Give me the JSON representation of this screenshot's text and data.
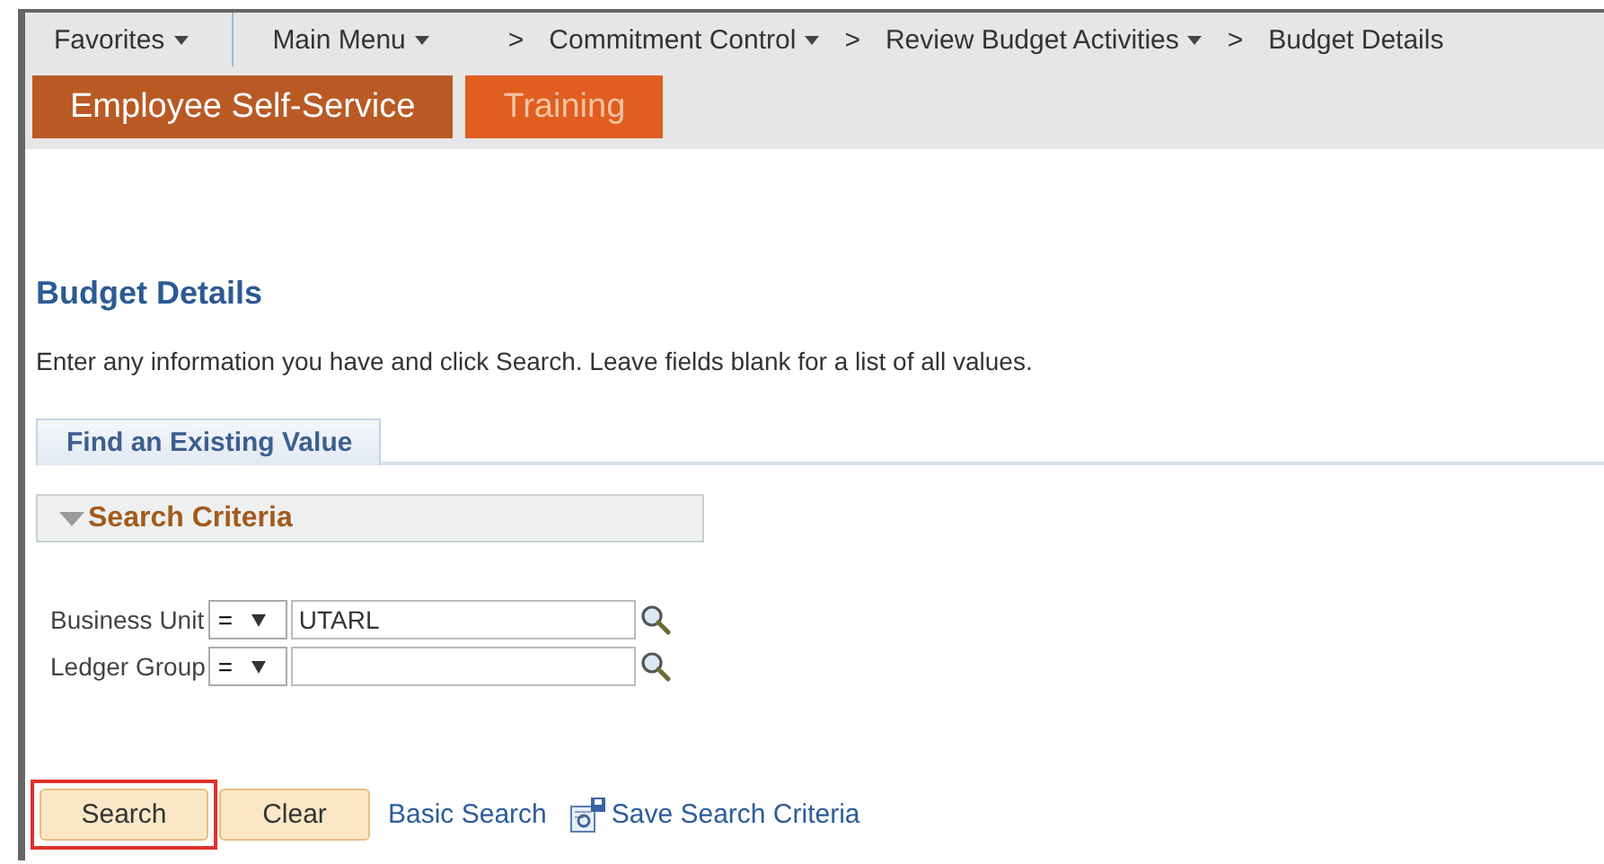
{
  "nav": [
    {
      "kind": "menu",
      "label": "Favorites",
      "dropdown": true
    },
    {
      "kind": "divider"
    },
    {
      "kind": "menu",
      "label": "Main Menu",
      "dropdown": true
    },
    {
      "kind": "separator",
      "label": ">"
    },
    {
      "kind": "menu",
      "label": "Commitment Control",
      "dropdown": true
    },
    {
      "kind": "separator",
      "label": ">"
    },
    {
      "kind": "menu",
      "label": "Review Budget Activities",
      "dropdown": true
    },
    {
      "kind": "separator",
      "label": ">"
    },
    {
      "kind": "menu",
      "label": "Budget Details",
      "dropdown": false
    }
  ],
  "home_tabs": [
    {
      "label": "Employee Self-Service",
      "selected": true
    },
    {
      "label": "Training",
      "selected": false
    }
  ],
  "page_title": "Budget Details",
  "instructions": "Enter any information you have and click Search. Leave fields blank for a list of all values.",
  "tabs": [
    {
      "label": "Find an Existing Value",
      "selected": true
    }
  ],
  "section": {
    "title": "Search Criteria",
    "expanded": true
  },
  "fields": [
    {
      "label": "Business Unit",
      "operator": "=",
      "value": "UTARL"
    },
    {
      "label": "Ledger Group",
      "operator": "="
    }
  ],
  "buttons": [
    {
      "label": "Search",
      "highlighted": true
    },
    {
      "label": "Clear",
      "highlighted": false
    }
  ],
  "links": [
    {
      "kind": "link",
      "label": "Basic Search"
    },
    {
      "kind": "save_icon"
    },
    {
      "kind": "link",
      "label": "Save Search Criteria"
    }
  ]
}
